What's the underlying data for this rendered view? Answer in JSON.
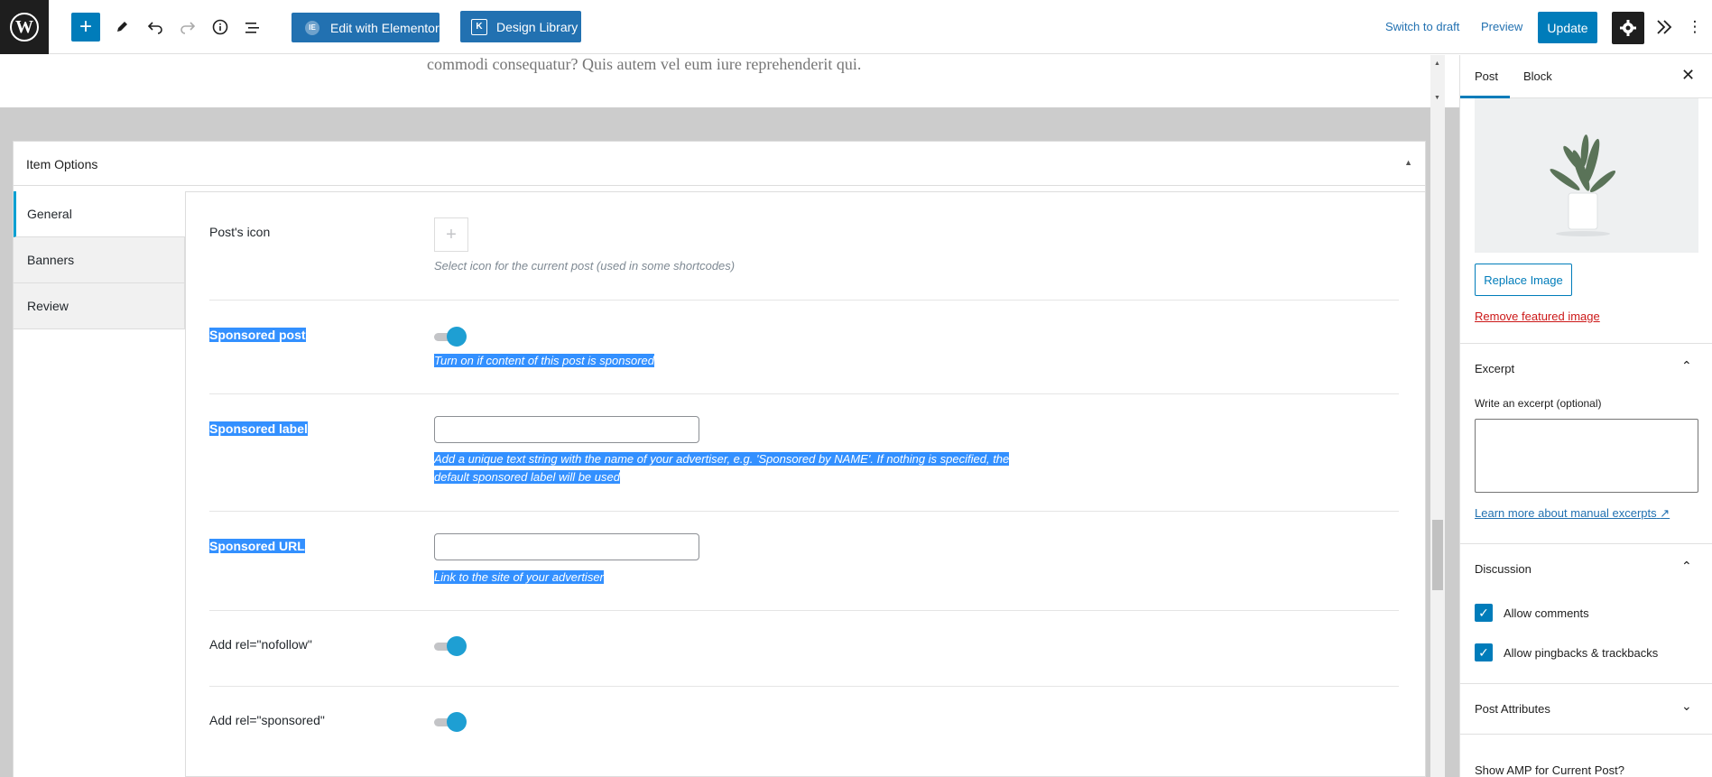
{
  "toolbar": {
    "logo": "W",
    "add_icon": "plus-icon",
    "edit_with_elementor": "Edit with Elementor",
    "elementor_glyph": "IE",
    "design_library": "Design Library",
    "design_library_glyph": "K",
    "switch_to_draft": "Switch to draft",
    "preview": "Preview",
    "update": "Update"
  },
  "editor": {
    "content_text": "commodi consequatur? Quis autem vel eum iure reprehenderit qui."
  },
  "item_options": {
    "title": "Item Options",
    "tabs": [
      {
        "label": "General"
      },
      {
        "label": "Banners"
      },
      {
        "label": "Review"
      }
    ],
    "fields": {
      "post_icon_label": "Post's icon",
      "post_icon_desc": "Select icon for the current post (used in some shortcodes)",
      "sponsored_post_label": "Sponsored post",
      "sponsored_post_desc": "Turn on if content of this post is sponsored",
      "sponsored_label_label": "Sponsored label",
      "sponsored_label_desc_1": "Add a unique text string with the name of your advertiser, e.g. 'Sponsored by NAME'. If nothing is specified, the",
      "sponsored_label_desc_2": "default sponsored label will be used",
      "sponsored_url_label": "Sponsored URL",
      "sponsored_url_desc": "Link to the site of your advertiser",
      "nofollow_label": "Add rel=\"nofollow\"",
      "sponsored_rel_label": "Add rel=\"sponsored\""
    }
  },
  "sidebar": {
    "tab_post": "Post",
    "tab_block": "Block",
    "replace_image": "Replace Image",
    "remove_featured_image": "Remove featured image",
    "excerpt_title": "Excerpt",
    "excerpt_label": "Write an excerpt (optional)",
    "learn_more": "Learn more about manual excerpts",
    "discussion_title": "Discussion",
    "allow_comments": "Allow comments",
    "allow_pingbacks": "Allow pingbacks & trackbacks",
    "post_attributes_title": "Post Attributes",
    "amp_title": "Show AMP for Current Post?"
  },
  "colors": {
    "accent": "#007cba",
    "selection": "#3390ff",
    "toggle_on": "#1e9fd3"
  }
}
